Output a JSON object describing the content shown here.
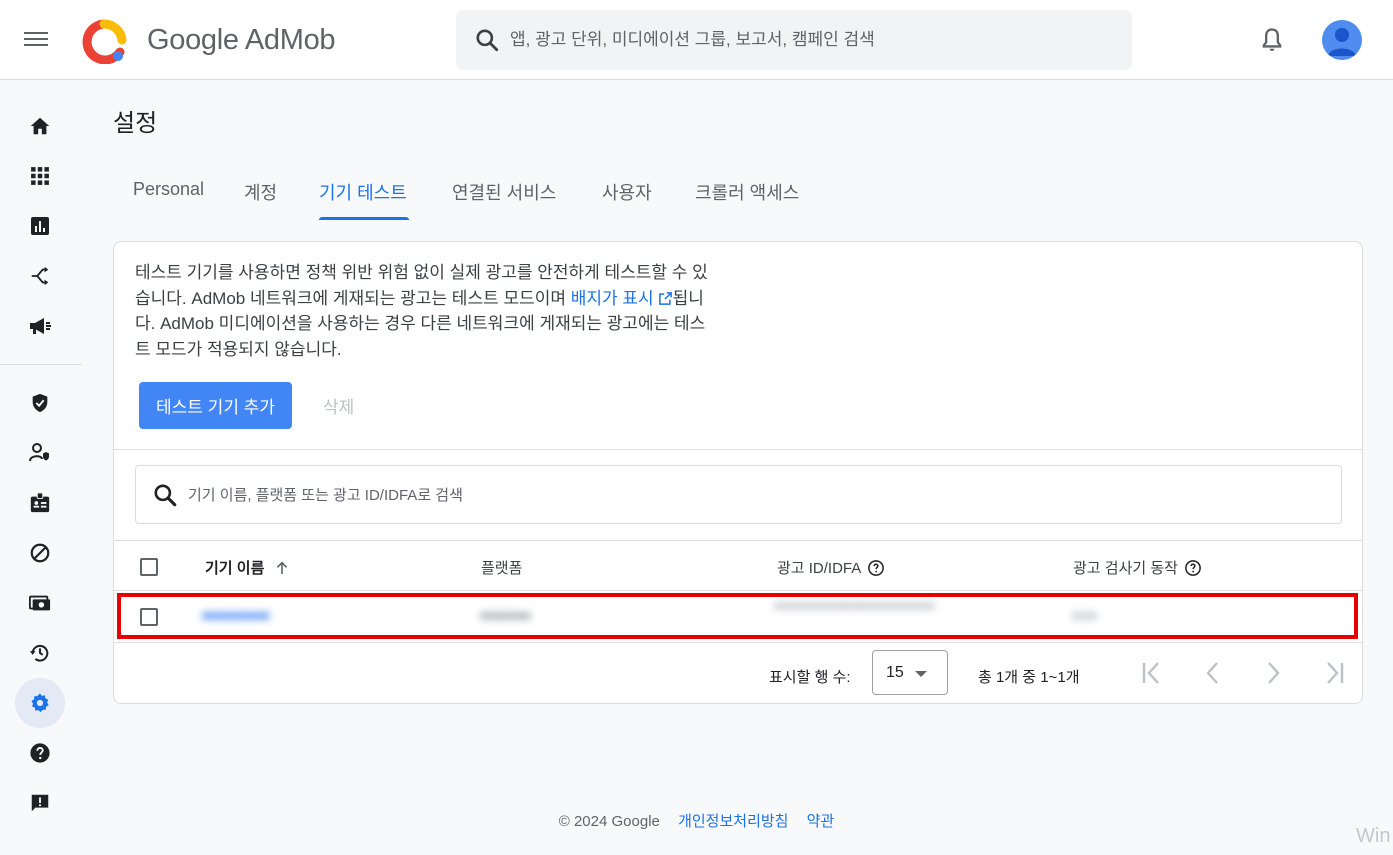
{
  "app": {
    "brand": "Google AdMob"
  },
  "search": {
    "placeholder": "앱, 광고 단위, 미디에이션 그룹, 보고서, 캠페인 검색"
  },
  "page": {
    "title": "설정"
  },
  "tabs": [
    {
      "label": "Personal"
    },
    {
      "label": "계정"
    },
    {
      "label": "기기 테스트",
      "active": true
    },
    {
      "label": "연결된 서비스"
    },
    {
      "label": "사용자"
    },
    {
      "label": "크롤러 액세스"
    }
  ],
  "card": {
    "desc_part1": "테스트 기기를 사용하면 정책 위반 위험 없이 실제 광고를 안전하게 테스트할 수 있습니다. AdMob 네트워크에 게재되는 광고는 테스트 모드이며 ",
    "desc_link": "배지가 표시",
    "desc_part2": "됩니다. AdMob 미디에이션을 사용하는 경우 다른 네트워크에 게재되는 광고에는 테스트 모드가 적용되지 않습니다.",
    "add_button": "테스트 기기 추가",
    "delete_button": "삭제",
    "table_search_placeholder": "기기 이름, 플랫폼 또는 광고 ID/IDFA로 검색"
  },
  "table": {
    "headers": {
      "device_name": "기기 이름",
      "platform": "플랫폼",
      "ad_id": "광고 ID/IDFA",
      "inspector": "광고 검사기 동작"
    },
    "rows": [
      {
        "device_name": "■■■■■■■■",
        "platform": "■■■■■■",
        "ad_id": "■■■■■■■■■■■■■■■■■■■",
        "inspector": "■■■"
      }
    ]
  },
  "pagination": {
    "rows_label": "표시할 행 수:",
    "rows_value": "15",
    "range": "총 1개 중 1~1개"
  },
  "footer": {
    "copyright": "© 2024 Google",
    "privacy": "개인정보처리방침",
    "terms": "약관"
  },
  "watermark": "Win",
  "colors": {
    "accent": "#1a73e8",
    "primary_button": "#4285f4",
    "highlight": "#e60000"
  }
}
